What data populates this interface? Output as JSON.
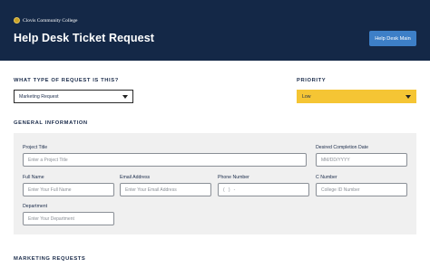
{
  "header": {
    "logo_text": "Clovis Community College",
    "title": "Help Desk Ticket Request",
    "help_button": "Help Desk Main"
  },
  "request_type": {
    "label": "WHAT TYPE OF REQUEST IS THIS?",
    "selected": "Marketing Request"
  },
  "priority": {
    "label": "PRIORITY",
    "selected": "Low",
    "color": "#f5c534"
  },
  "general": {
    "label": "GENERAL INFORMATION",
    "fields": {
      "project_title": {
        "label": "Project Title",
        "placeholder": "Enter a Project Title"
      },
      "completion_date": {
        "label": "Desired Completion Date",
        "placeholder": "MM/DD/YYYY"
      },
      "full_name": {
        "label": "Full Name",
        "placeholder": "Enter Your Full Name"
      },
      "email": {
        "label": "Email Address",
        "placeholder": "Enter Your Email Address"
      },
      "phone": {
        "label": "Phone Number",
        "placeholder": "(   )   -"
      },
      "c_number": {
        "label": "C  Number",
        "placeholder": "College ID Number"
      },
      "department": {
        "label": "Department",
        "placeholder": "Enter Your Department"
      }
    }
  },
  "marketing": {
    "label": "MARKETING REQUESTS"
  },
  "colors": {
    "header_bg": "#142847",
    "button_bg": "#3d7fc7",
    "panel_bg": "#f0f0f0"
  }
}
